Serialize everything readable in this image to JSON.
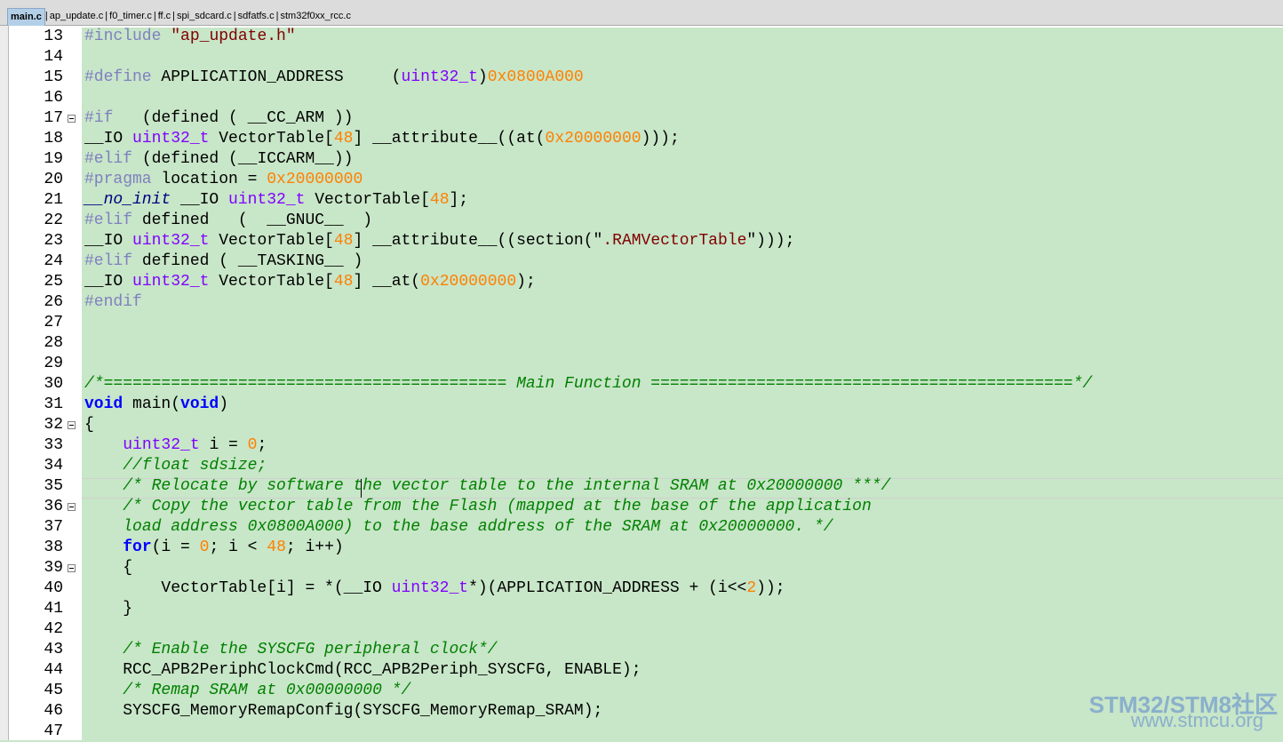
{
  "tabs": [
    {
      "label": "main.c",
      "active": true
    },
    {
      "label": "ap_update.c",
      "active": false
    },
    {
      "label": "f0_timer.c",
      "active": false
    },
    {
      "label": "ff.c",
      "active": false
    },
    {
      "label": "spi_sdcard.c",
      "active": false
    },
    {
      "label": "sdfatfs.c",
      "active": false
    },
    {
      "label": "stm32f0xx_rcc.c",
      "active": false
    }
  ],
  "editor": {
    "current_line": 35,
    "lines": [
      {
        "n": 13,
        "fold": false,
        "text": "#include \"ap_update.h\""
      },
      {
        "n": 14,
        "fold": false,
        "text": ""
      },
      {
        "n": 15,
        "fold": false,
        "text": "#define APPLICATION_ADDRESS     (uint32_t)0x0800A000"
      },
      {
        "n": 16,
        "fold": false,
        "text": ""
      },
      {
        "n": 17,
        "fold": true,
        "text": "#if   (defined ( __CC_ARM ))"
      },
      {
        "n": 18,
        "fold": false,
        "text": "__IO uint32_t VectorTable[48] __attribute__((at(0x20000000)));"
      },
      {
        "n": 19,
        "fold": false,
        "text": "#elif (defined (__ICCARM__))"
      },
      {
        "n": 20,
        "fold": false,
        "text": "#pragma location = 0x20000000"
      },
      {
        "n": 21,
        "fold": false,
        "text": "__no_init __IO uint32_t VectorTable[48];"
      },
      {
        "n": 22,
        "fold": false,
        "text": "#elif defined   (  __GNUC__  )"
      },
      {
        "n": 23,
        "fold": false,
        "text": "__IO uint32_t VectorTable[48] __attribute__((section(\".RAMVectorTable\")));"
      },
      {
        "n": 24,
        "fold": false,
        "text": "#elif defined ( __TASKING__ )"
      },
      {
        "n": 25,
        "fold": false,
        "text": "__IO uint32_t VectorTable[48] __at(0x20000000);"
      },
      {
        "n": 26,
        "fold": false,
        "text": "#endif"
      },
      {
        "n": 27,
        "fold": false,
        "text": ""
      },
      {
        "n": 28,
        "fold": false,
        "text": ""
      },
      {
        "n": 29,
        "fold": false,
        "text": ""
      },
      {
        "n": 30,
        "fold": false,
        "text": "/*========================================== Main Function ============================================*/"
      },
      {
        "n": 31,
        "fold": false,
        "text": "void main(void)"
      },
      {
        "n": 32,
        "fold": true,
        "text": "{"
      },
      {
        "n": 33,
        "fold": false,
        "text": "    uint32_t i = 0;"
      },
      {
        "n": 34,
        "fold": false,
        "text": "    //float sdsize;"
      },
      {
        "n": 35,
        "fold": false,
        "text": "    /* Relocate by software the vector table to the internal SRAM at 0x20000000 ***/"
      },
      {
        "n": 36,
        "fold": true,
        "text": "    /* Copy the vector table from the Flash (mapped at the base of the application"
      },
      {
        "n": 37,
        "fold": false,
        "text": "    load address 0x0800A000) to the base address of the SRAM at 0x20000000. */"
      },
      {
        "n": 38,
        "fold": false,
        "text": "    for(i = 0; i < 48; i++)"
      },
      {
        "n": 39,
        "fold": true,
        "text": "    {"
      },
      {
        "n": 40,
        "fold": false,
        "text": "        VectorTable[i] = *(__IO uint32_t*)(APPLICATION_ADDRESS + (i<<2));"
      },
      {
        "n": 41,
        "fold": false,
        "text": "    }"
      },
      {
        "n": 42,
        "fold": false,
        "text": ""
      },
      {
        "n": 43,
        "fold": false,
        "text": "    /* Enable the SYSCFG peripheral clock*/"
      },
      {
        "n": 44,
        "fold": false,
        "text": "    RCC_APB2PeriphClockCmd(RCC_APB2Periph_SYSCFG, ENABLE);"
      },
      {
        "n": 45,
        "fold": false,
        "text": "    /* Remap SRAM at 0x00000000 */"
      },
      {
        "n": 46,
        "fold": false,
        "text": "    SYSCFG_MemoryRemapConfig(SYSCFG_MemoryRemap_SRAM);"
      },
      {
        "n": 47,
        "fold": false,
        "text": ""
      }
    ]
  },
  "watermark": {
    "line1": "STM32/STM8社区",
    "line2": "www.stmcu.org"
  },
  "colors": {
    "editor_bg": "#c8e6c8",
    "preprocessor": "#8080c0",
    "string": "#800000",
    "number": "#ff8000",
    "keyword": "#0000ff",
    "type": "#8000ff",
    "comment": "#008000"
  }
}
